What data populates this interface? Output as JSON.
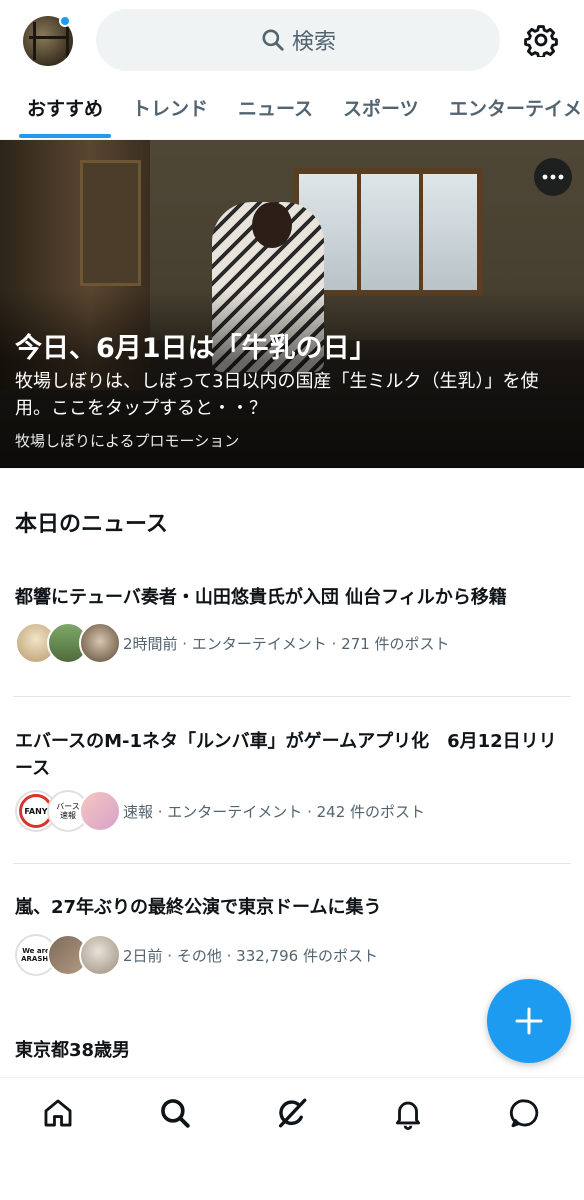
{
  "header": {
    "search_placeholder": "検索",
    "notification_dot_color": "#1d9bf0"
  },
  "tabs": [
    {
      "label": "おすすめ",
      "active": true
    },
    {
      "label": "トレンド",
      "active": false
    },
    {
      "label": "ニュース",
      "active": false
    },
    {
      "label": "スポーツ",
      "active": false
    },
    {
      "label": "エンターテイメ",
      "active": false
    }
  ],
  "hero": {
    "title": "今日、6月1日は「牛乳の日」",
    "description": "牧場しぼりは、しぼって3日以内の国産「生ミルク（生乳）」を使用。ここをタップすると・・？",
    "promoted_by": "牧場しぼりによるプロモーション"
  },
  "news_section": {
    "title": "本日のニュース",
    "items": [
      {
        "headline": "都響にテューバ奏者・山田悠貴氏が入団 仙台フィルから移籍",
        "meta": "2時間前 · エンターテイメント · 271 件のポスト"
      },
      {
        "headline": "エバースのM-1ネタ「ルンバ車」がゲームアプリ化　6月12日リリース",
        "meta": "速報 · エンターテイメント · 242 件のポスト",
        "avatar_labels": [
          "FANY",
          "バース 速報"
        ]
      },
      {
        "headline": "嵐、27年ぶりの最終公演で東京ドームに集う",
        "meta": "2日前 · その他 · 332,796 件のポスト",
        "avatar_labels": [
          "We are ARASHI"
        ]
      },
      {
        "headline": "東京都38歳男"
      }
    ]
  },
  "colors": {
    "accent": "#1d9bf0",
    "text_primary": "#0f1419",
    "text_secondary": "#536471"
  },
  "bottom_nav": [
    {
      "icon": "home-icon"
    },
    {
      "icon": "search-icon"
    },
    {
      "icon": "grok-icon"
    },
    {
      "icon": "bell-icon"
    },
    {
      "icon": "message-icon"
    }
  ]
}
